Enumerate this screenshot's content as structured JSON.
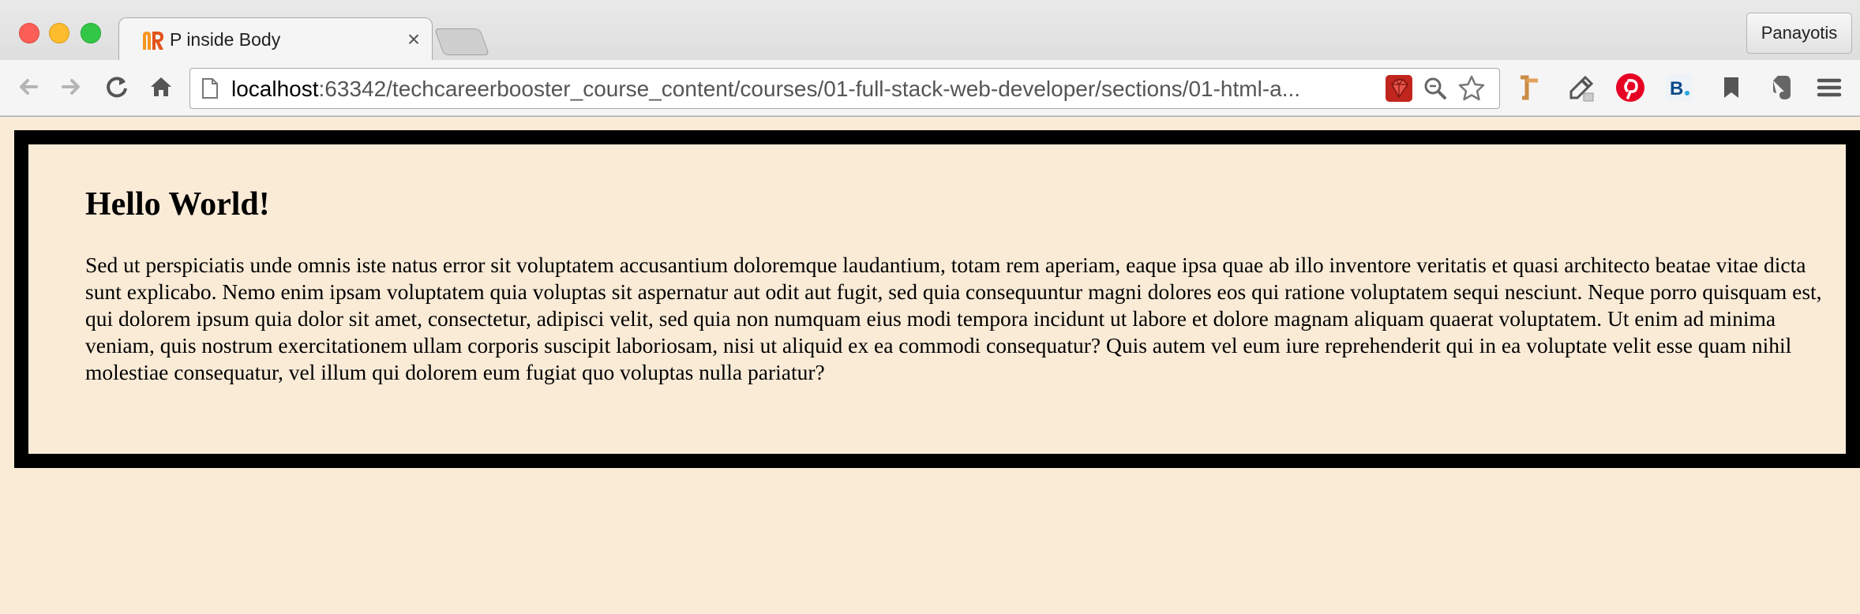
{
  "browser": {
    "tab": {
      "title": "P inside Body",
      "close_glyph": "×"
    },
    "profile_name": "Panayotis",
    "omnibox": {
      "url_host": "localhost",
      "url_rest": ":63342/techcareerbooster_course_content/courses/01-full-stack-web-developer/sections/01-html-a..."
    },
    "icons": {
      "back": "back-arrow-icon",
      "forward": "forward-arrow-icon",
      "reload": "reload-icon",
      "home": "home-icon",
      "page": "page-icon",
      "ruby": "ruby-gem-icon",
      "zoom": "magnifier-icon",
      "bookmark_star": "star-icon"
    },
    "colors": {
      "page_background": "#faebd7",
      "box_border": "#000000",
      "pinterest": "#e60023",
      "ruby": "#c0261d"
    }
  },
  "page": {
    "heading": "Hello World!",
    "paragraph": "Sed ut perspiciatis unde omnis iste natus error sit voluptatem accusantium doloremque laudantium, totam rem aperiam, eaque ipsa quae ab illo inventore veritatis et quasi architecto beatae vitae dicta sunt explicabo. Nemo enim ipsam voluptatem quia voluptas sit aspernatur aut odit aut fugit, sed quia consequuntur magni dolores eos qui ratione voluptatem sequi nesciunt. Neque porro quisquam est, qui dolorem ipsum quia dolor sit amet, consectetur, adipisci velit, sed quia non numquam eius modi tempora incidunt ut labore et dolore magnam aliquam quaerat voluptatem. Ut enim ad minima veniam, quis nostrum exercitationem ullam corporis suscipit laboriosam, nisi ut aliquid ex ea commodi consequatur? Quis autem vel eum iure reprehenderit qui in ea voluptate velit esse quam nihil molestiae consequatur, vel illum qui dolorem eum fugiat quo voluptas nulla pariatur?"
  }
}
